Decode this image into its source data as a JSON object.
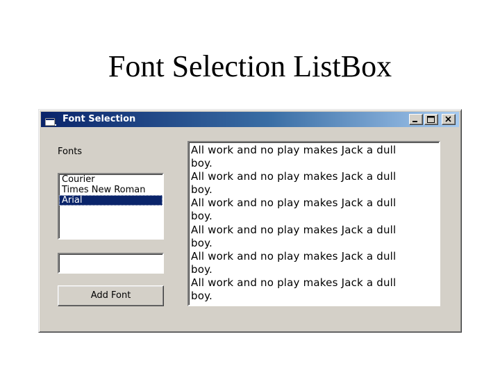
{
  "slide": {
    "title": "Font Selection ListBox"
  },
  "window": {
    "title": "Font Selection",
    "icon": "app-icon",
    "caption_buttons": [
      "minimize-icon",
      "maximize-icon",
      "close-icon"
    ]
  },
  "fonts_label": "Fonts",
  "listbox": {
    "items": [
      "Courier",
      "Times New Roman",
      "Arial"
    ],
    "selected": "Arial"
  },
  "font_input": {
    "value": ""
  },
  "add_button": {
    "label": "Add Font"
  },
  "textarea": {
    "text": "All work and no play makes Jack a dull\nboy.\nAll work and no play makes Jack a dull\nboy.\nAll work and no play makes Jack a dull\nboy.\nAll work and no play makes Jack a dull\nboy.\nAll work and no play makes Jack a dull\nboy.\nAll work and no play makes Jack a dull\nboy."
  },
  "colors": {
    "titlebar_start": "#0a246a",
    "titlebar_end": "#a6caf0",
    "window_face": "#d4d0c8",
    "selection": "#0a246a"
  }
}
